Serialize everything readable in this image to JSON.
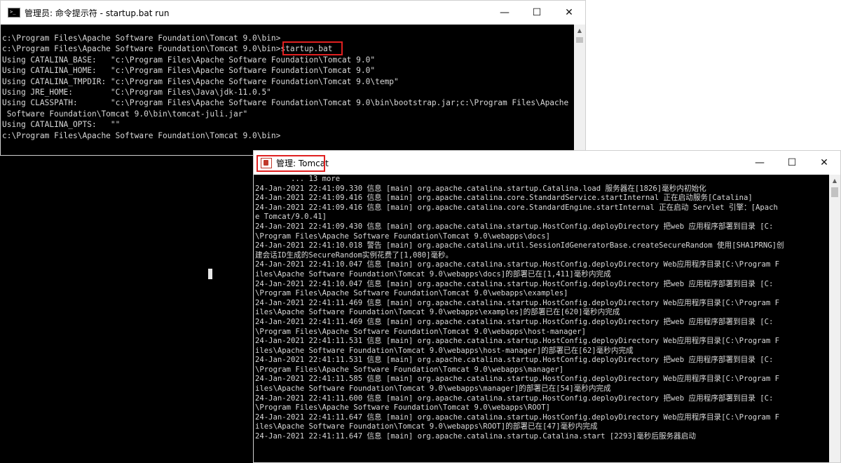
{
  "cmd_window": {
    "title": "管理员: 命令提示符 - startup.bat  run",
    "lines": [
      "c:\\Program Files\\Apache Software Foundation\\Tomcat 9.0\\bin>",
      "c:\\Program Files\\Apache Software Foundation\\Tomcat 9.0\\bin>startup.bat",
      "Using CATALINA_BASE:   \"c:\\Program Files\\Apache Software Foundation\\Tomcat 9.0\"",
      "Using CATALINA_HOME:   \"c:\\Program Files\\Apache Software Foundation\\Tomcat 9.0\"",
      "Using CATALINA_TMPDIR: \"c:\\Program Files\\Apache Software Foundation\\Tomcat 9.0\\temp\"",
      "Using JRE_HOME:        \"C:\\Program Files\\Java\\jdk-11.0.5\"",
      "Using CLASSPATH:       \"c:\\Program Files\\Apache Software Foundation\\Tomcat 9.0\\bin\\bootstrap.jar;c:\\Program Files\\Apache",
      " Software Foundation\\Tomcat 9.0\\bin\\tomcat-juli.jar\"",
      "Using CATALINA_OPTS:   \"\"",
      "c:\\Program Files\\Apache Software Foundation\\Tomcat 9.0\\bin>"
    ],
    "highlighted_command": "startup.bat"
  },
  "tomcat_window": {
    "title": "管理: Tomcat",
    "lines": [
      "        ... 13 more",
      "24-Jan-2021 22:41:09.330 信息 [main] org.apache.catalina.startup.Catalina.load 服务器在[1826]毫秒内初始化",
      "24-Jan-2021 22:41:09.416 信息 [main] org.apache.catalina.core.StandardService.startInternal 正在启动服务[Catalina]",
      "24-Jan-2021 22:41:09.416 信息 [main] org.apache.catalina.core.StandardEngine.startInternal 正在启动 Servlet 引擎：[Apach",
      "e Tomcat/9.0.41]",
      "24-Jan-2021 22:41:09.430 信息 [main] org.apache.catalina.startup.HostConfig.deployDirectory 把web 应用程序部署到目录 [C:",
      "\\Program Files\\Apache Software Foundation\\Tomcat 9.0\\webapps\\docs]",
      "24-Jan-2021 22:41:10.018 警告 [main] org.apache.catalina.util.SessionIdGeneratorBase.createSecureRandom 使用[SHA1PRNG]创",
      "建会话ID生成的SecureRandom实例花费了[1,080]毫秒。",
      "24-Jan-2021 22:41:10.047 信息 [main] org.apache.catalina.startup.HostConfig.deployDirectory Web应用程序目录[C:\\Program F",
      "iles\\Apache Software Foundation\\Tomcat 9.0\\webapps\\docs]的部署已在[1,411]毫秒内完成",
      "24-Jan-2021 22:41:10.047 信息 [main] org.apache.catalina.startup.HostConfig.deployDirectory 把web 应用程序部署到目录 [C:",
      "\\Program Files\\Apache Software Foundation\\Tomcat 9.0\\webapps\\examples]",
      "24-Jan-2021 22:41:11.469 信息 [main] org.apache.catalina.startup.HostConfig.deployDirectory Web应用程序目录[C:\\Program F",
      "iles\\Apache Software Foundation\\Tomcat 9.0\\webapps\\examples]的部署已在[620]毫秒内完成",
      "24-Jan-2021 22:41:11.469 信息 [main] org.apache.catalina.startup.HostConfig.deployDirectory 把web 应用程序部署到目录 [C:",
      "\\Program Files\\Apache Software Foundation\\Tomcat 9.0\\webapps\\host-manager]",
      "24-Jan-2021 22:41:11.531 信息 [main] org.apache.catalina.startup.HostConfig.deployDirectory Web应用程序目录[C:\\Program F",
      "iles\\Apache Software Foundation\\Tomcat 9.0\\webapps\\host-manager]的部署已在[62]毫秒内完成",
      "24-Jan-2021 22:41:11.531 信息 [main] org.apache.catalina.startup.HostConfig.deployDirectory 把web 应用程序部署到目录 [C:",
      "\\Program Files\\Apache Software Foundation\\Tomcat 9.0\\webapps\\manager]",
      "24-Jan-2021 22:41:11.585 信息 [main] org.apache.catalina.startup.HostConfig.deployDirectory Web应用程序目录[C:\\Program F",
      "iles\\Apache Software Foundation\\Tomcat 9.0\\webapps\\manager]的部署已在[54]毫秒内完成",
      "24-Jan-2021 22:41:11.600 信息 [main] org.apache.catalina.startup.HostConfig.deployDirectory 把web 应用程序部署到目录 [C:",
      "\\Program Files\\Apache Software Foundation\\Tomcat 9.0\\webapps\\ROOT]",
      "24-Jan-2021 22:41:11.647 信息 [main] org.apache.catalina.startup.HostConfig.deployDirectory Web应用程序目录[C:\\Program F",
      "iles\\Apache Software Foundation\\Tomcat 9.0\\webapps\\ROOT]的部署已在[47]毫秒内完成",
      "24-Jan-2021 22:41:11.647 信息 [main] org.apache.catalina.startup.Catalina.start [2293]毫秒后服务器启动"
    ]
  },
  "window_controls": {
    "minimize": "—",
    "maximize": "☐",
    "close": "✕"
  },
  "colors": {
    "console_bg": "#000000",
    "console_text": "#d8d8d8",
    "highlight": "#e02020",
    "titlebar_bg": "#ffffff"
  },
  "icons": {
    "cmd": "cmd-icon",
    "tomcat": "tomcat-icon"
  }
}
